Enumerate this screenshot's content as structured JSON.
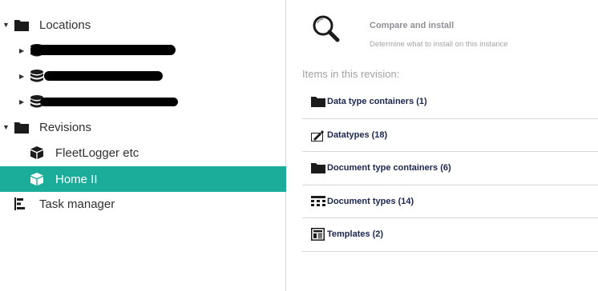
{
  "tree": {
    "locations": {
      "label": "Locations",
      "icon": "folder-icon"
    },
    "location_children": [
      {
        "icon": "database-icon",
        "label_redacted": true
      },
      {
        "icon": "database-icon",
        "label_redacted": true
      },
      {
        "icon": "database-icon",
        "label_redacted": true
      }
    ],
    "revisions": {
      "label": "Revisions",
      "icon": "folder-icon"
    },
    "revision_children": [
      {
        "label": "FleetLogger etc",
        "icon": "package-icon",
        "selected": false
      },
      {
        "label": "Home II",
        "icon": "package-icon",
        "selected": true
      }
    ],
    "task_manager": {
      "label": "Task manager",
      "icon": "task-manager-icon"
    },
    "selected_color": "#1cad9a"
  },
  "panel": {
    "action": {
      "title": "Compare and install",
      "subtitle": "Determine what to install on this instance",
      "icon": "magnifier-icon"
    },
    "items_title": "Items in this revision:",
    "items": [
      {
        "label": "Data type containers (1)",
        "icon": "folder-icon"
      },
      {
        "label": "Datatypes (18)",
        "icon": "datatype-icon"
      },
      {
        "label": "Document type containers (6)",
        "icon": "folder-icon"
      },
      {
        "label": "Document types (14)",
        "icon": "document-type-icon"
      },
      {
        "label": "Templates (2)",
        "icon": "template-icon"
      }
    ]
  }
}
